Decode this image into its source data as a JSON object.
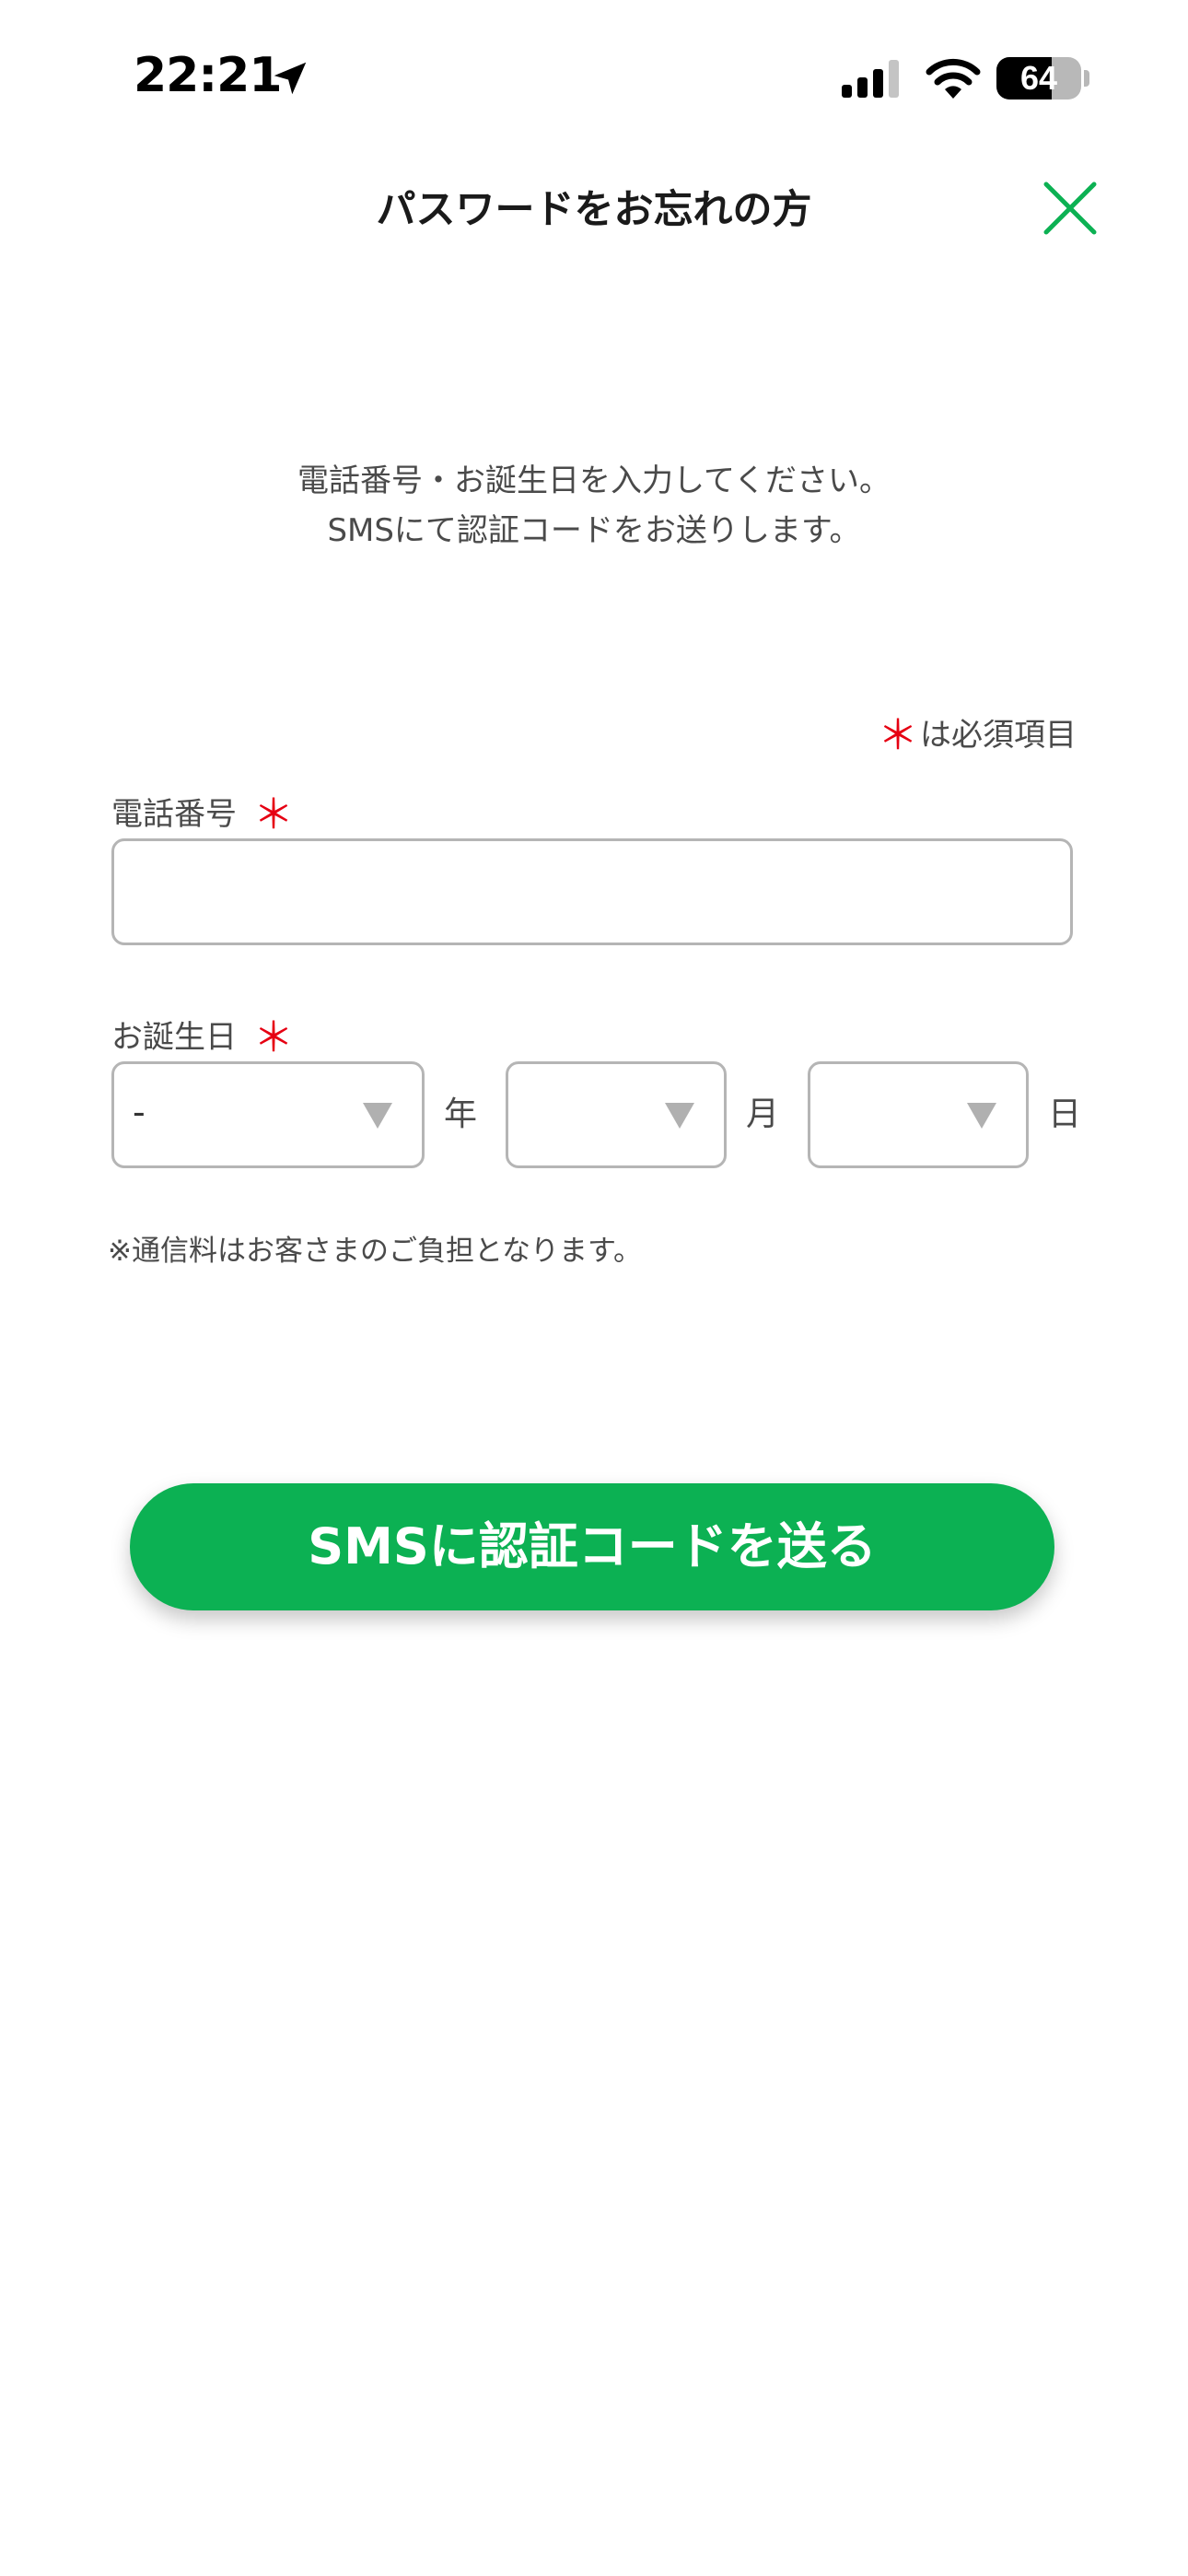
{
  "status_bar": {
    "time": "22:21",
    "battery_level": "64",
    "icons": [
      "location-arrow-icon",
      "cellular-signal-icon",
      "wifi-icon",
      "battery-icon"
    ]
  },
  "header": {
    "title": "パスワードをお忘れの方",
    "close_icon": "close-icon"
  },
  "intro": {
    "line1": "電話番号・お誕生日を入力してください。",
    "line2": "SMSにて認証コードをお送りします。"
  },
  "required_note": {
    "mark": "＊",
    "text": "は必須項目"
  },
  "phone": {
    "label": "電話番号",
    "required_mark": "＊",
    "value": ""
  },
  "birthday": {
    "label": "お誕生日",
    "required_mark": "＊",
    "year_value": "-",
    "month_value": "",
    "day_value": "",
    "year_unit": "年",
    "month_unit": "月",
    "day_unit": "日"
  },
  "note": "※通信料はお客さまのご負担となります。",
  "submit_label": "SMSに認証コードを送る",
  "colors": {
    "accent_green": "#0cb153",
    "required_red": "#e60012",
    "text_gray": "#4a4a4a",
    "border_gray": "#b5b5b5"
  }
}
